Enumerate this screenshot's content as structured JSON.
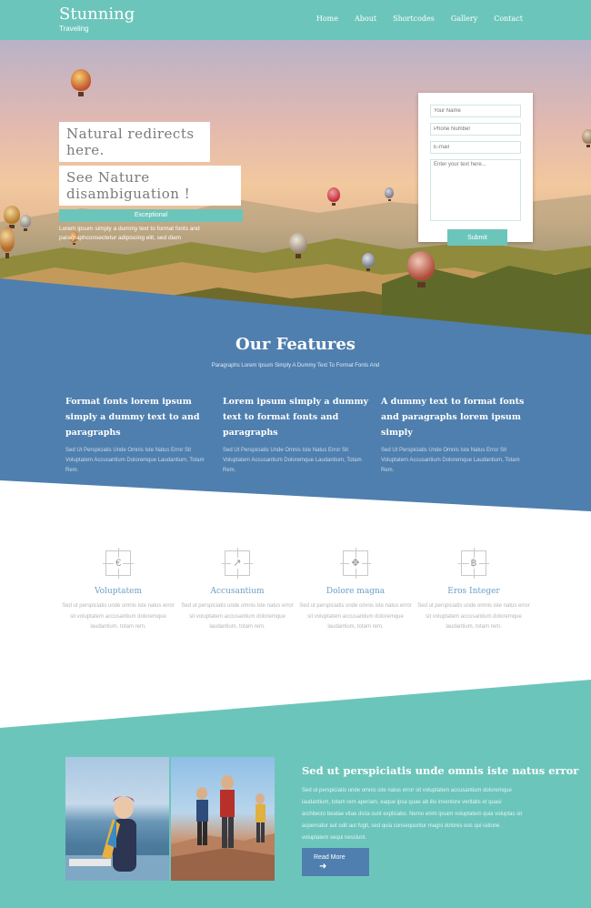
{
  "brand": {
    "name": "Stunning",
    "tagline": "Traveling"
  },
  "nav": [
    "Home",
    "About",
    "Shortcodes",
    "Gallery",
    "Contact"
  ],
  "hero": {
    "line1": "Natural redirects here.",
    "line2": "See Nature disambiguation !",
    "badge": "Exceptional",
    "description": "Lorem ipsum simply a dummy text to format fonts and paragraphconsectetur adipiscing elit, sed diam"
  },
  "form": {
    "name_placeholder": "Your Name",
    "phone_placeholder": "Phone Number",
    "email_placeholder": "E-mail",
    "message_placeholder": "Enter your text here...",
    "submit_label": "Submit"
  },
  "features": {
    "title": "Our Features",
    "subtitle": "Paragraphs Lorem Ipsum Simply A Dummy Text To Format Fonts And",
    "columns": [
      {
        "heading": "Format fonts lorem ipsum simply a dummy text to and paragraphs",
        "text": "Sed Ut Perspiciatis Unde Omnis Iste Natus Error Sit Voluptatem Accusantium Doloremque Laudantium, Totam Rem."
      },
      {
        "heading": "Lorem ipsum simply a dummy text to format fonts and paragraphs",
        "text": "Sed Ut Perspiciatis Unde Omnis Iste Natus Error Sit Voluptatem Accusantium Doloremque Laudantium, Totam Rem."
      },
      {
        "heading": "A dummy text to format fonts and paragraphs lorem ipsum simply",
        "text": "Sed Ut Perspiciatis Unde Omnis Iste Natus Error Sit Voluptatem Accusantium Doloremque Laudantium, Totam Rem."
      }
    ]
  },
  "services": [
    {
      "icon": "euro-icon",
      "glyph": "€",
      "title": "Voluptatem",
      "text": "Sed ut perspiciatis unde omnis iste natus error sit voluptatem accusantium doloremque laudantium, totam rem."
    },
    {
      "icon": "share-icon",
      "glyph": "↗",
      "title": "Accusantium",
      "text": "Sed ut perspiciatis unde omnis iste natus error sit voluptatem accusantium doloremque laudantium, totam rem."
    },
    {
      "icon": "move-icon",
      "glyph": "✥",
      "title": "Dolore magna",
      "text": "Sed ut perspiciatis unde omnis iste natus error sit voluptatem accusantium doloremque laudantium, totam rem."
    },
    {
      "icon": "bitcoin-icon",
      "glyph": "฿",
      "title": "Eros Integer",
      "text": "Sed ut perspiciatis unde omnis iste natus error sit voluptatem accusantium doloremque laudantium, totam rem."
    }
  ],
  "about": {
    "title": "Sed ut perspiciatis unde omnis iste natus error",
    "text": "Sed ut perspiciatis unde omnis iste natus error sit voluptatem accusantium doloremque laudantium, totam rem aperiam, eaque ipsa quae ab illo inventore veritatis et quasi architecto beatae vitae dicta sunt explicabo. Nemo enim ipsam voluptatem quia voluptas sit aspernatur aut odit aut fugit, sed quia consequuntur magni dolores eos qui ratione voluptatem sequi nesciunt.",
    "button_label": "Read More",
    "button_icon": "➜"
  },
  "colors": {
    "teal": "#6cc5bb",
    "blue_band": "#4f7fae",
    "white": "#ffffff"
  }
}
